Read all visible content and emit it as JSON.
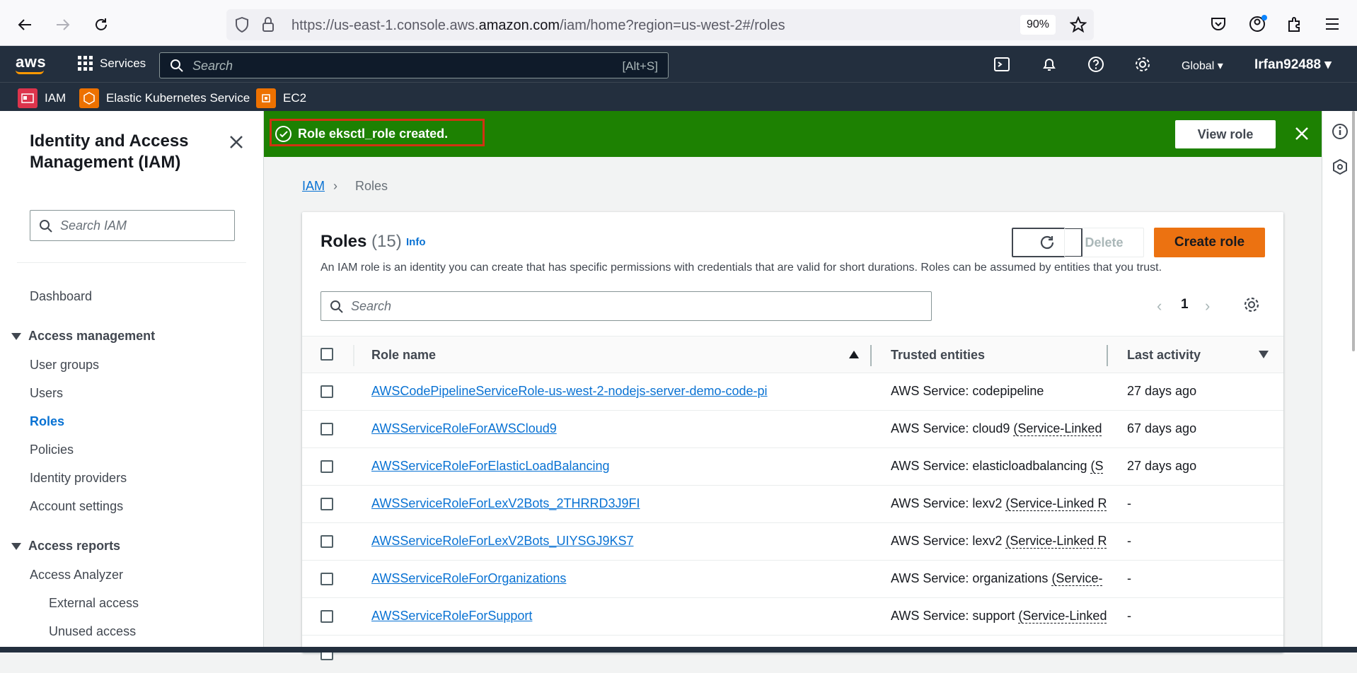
{
  "browser": {
    "url_prefix": "https://us-east-1.console.aws.",
    "url_domain": "amazon.com",
    "url_suffix": "/iam/home?region=us-west-2#/roles",
    "zoom": "90%"
  },
  "topnav": {
    "logo": "aws",
    "services_label": "Services",
    "search_placeholder": "Search",
    "search_shortcut": "[Alt+S]",
    "region": "Global",
    "account": "Irfan92488"
  },
  "favorites": [
    {
      "label": "IAM",
      "color": "#dd344c"
    },
    {
      "label": "Elastic Kubernetes Service",
      "color": "#ed7100"
    },
    {
      "label": "EC2",
      "color": "#ed7100"
    }
  ],
  "sidebar": {
    "title": "Identity and Access Management (IAM)",
    "search_placeholder": "Search IAM",
    "dashboard": "Dashboard",
    "access_management": "Access management",
    "am_items": [
      "User groups",
      "Users",
      "Roles",
      "Policies",
      "Identity providers",
      "Account settings"
    ],
    "access_reports": "Access reports",
    "ar_items": [
      "Access Analyzer",
      "External access",
      "Unused access"
    ]
  },
  "flash": {
    "message": "Role eksctl_role created.",
    "button": "View role",
    "color": "#1d8102"
  },
  "breadcrumb": {
    "root": "IAM",
    "current": "Roles"
  },
  "roles": {
    "title": "Roles",
    "count": "(15)",
    "info": "Info",
    "description": "An IAM role is an identity you can create that has specific permissions with credentials that are valid for short durations. Roles can be assumed by entities that you trust.",
    "delete_label": "Delete",
    "create_label": "Create role",
    "search_placeholder": "Search",
    "page": "1",
    "columns": [
      "Role name",
      "Trusted entities",
      "Last activity"
    ],
    "rows": [
      {
        "name": "AWSCodePipelineServiceRole-us-west-2-nodejs-server-demo-code-pi",
        "trust_main": "AWS Service: codepipeline",
        "trust_extra": "",
        "activity": "27 days ago"
      },
      {
        "name": "AWSServiceRoleForAWSCloud9",
        "trust_main": "AWS Service: cloud9 ",
        "trust_extra": "(Service-Linked",
        "activity": "67 days ago"
      },
      {
        "name": "AWSServiceRoleForElasticLoadBalancing",
        "trust_main": "AWS Service: elasticloadbalancing ",
        "trust_extra": "(S",
        "activity": "27 days ago"
      },
      {
        "name": "AWSServiceRoleForLexV2Bots_2THRRD3J9FI",
        "trust_main": "AWS Service: lexv2 ",
        "trust_extra": "(Service-Linked R",
        "activity": "-"
      },
      {
        "name": "AWSServiceRoleForLexV2Bots_UIYSGJ9KS7",
        "trust_main": "AWS Service: lexv2 ",
        "trust_extra": "(Service-Linked R",
        "activity": "-"
      },
      {
        "name": "AWSServiceRoleForOrganizations",
        "trust_main": "AWS Service: organizations ",
        "trust_extra": "(Service-",
        "activity": "-"
      },
      {
        "name": "AWSServiceRoleForSupport",
        "trust_main": "AWS Service: support ",
        "trust_extra": "(Service-Linked",
        "activity": "-"
      }
    ]
  }
}
